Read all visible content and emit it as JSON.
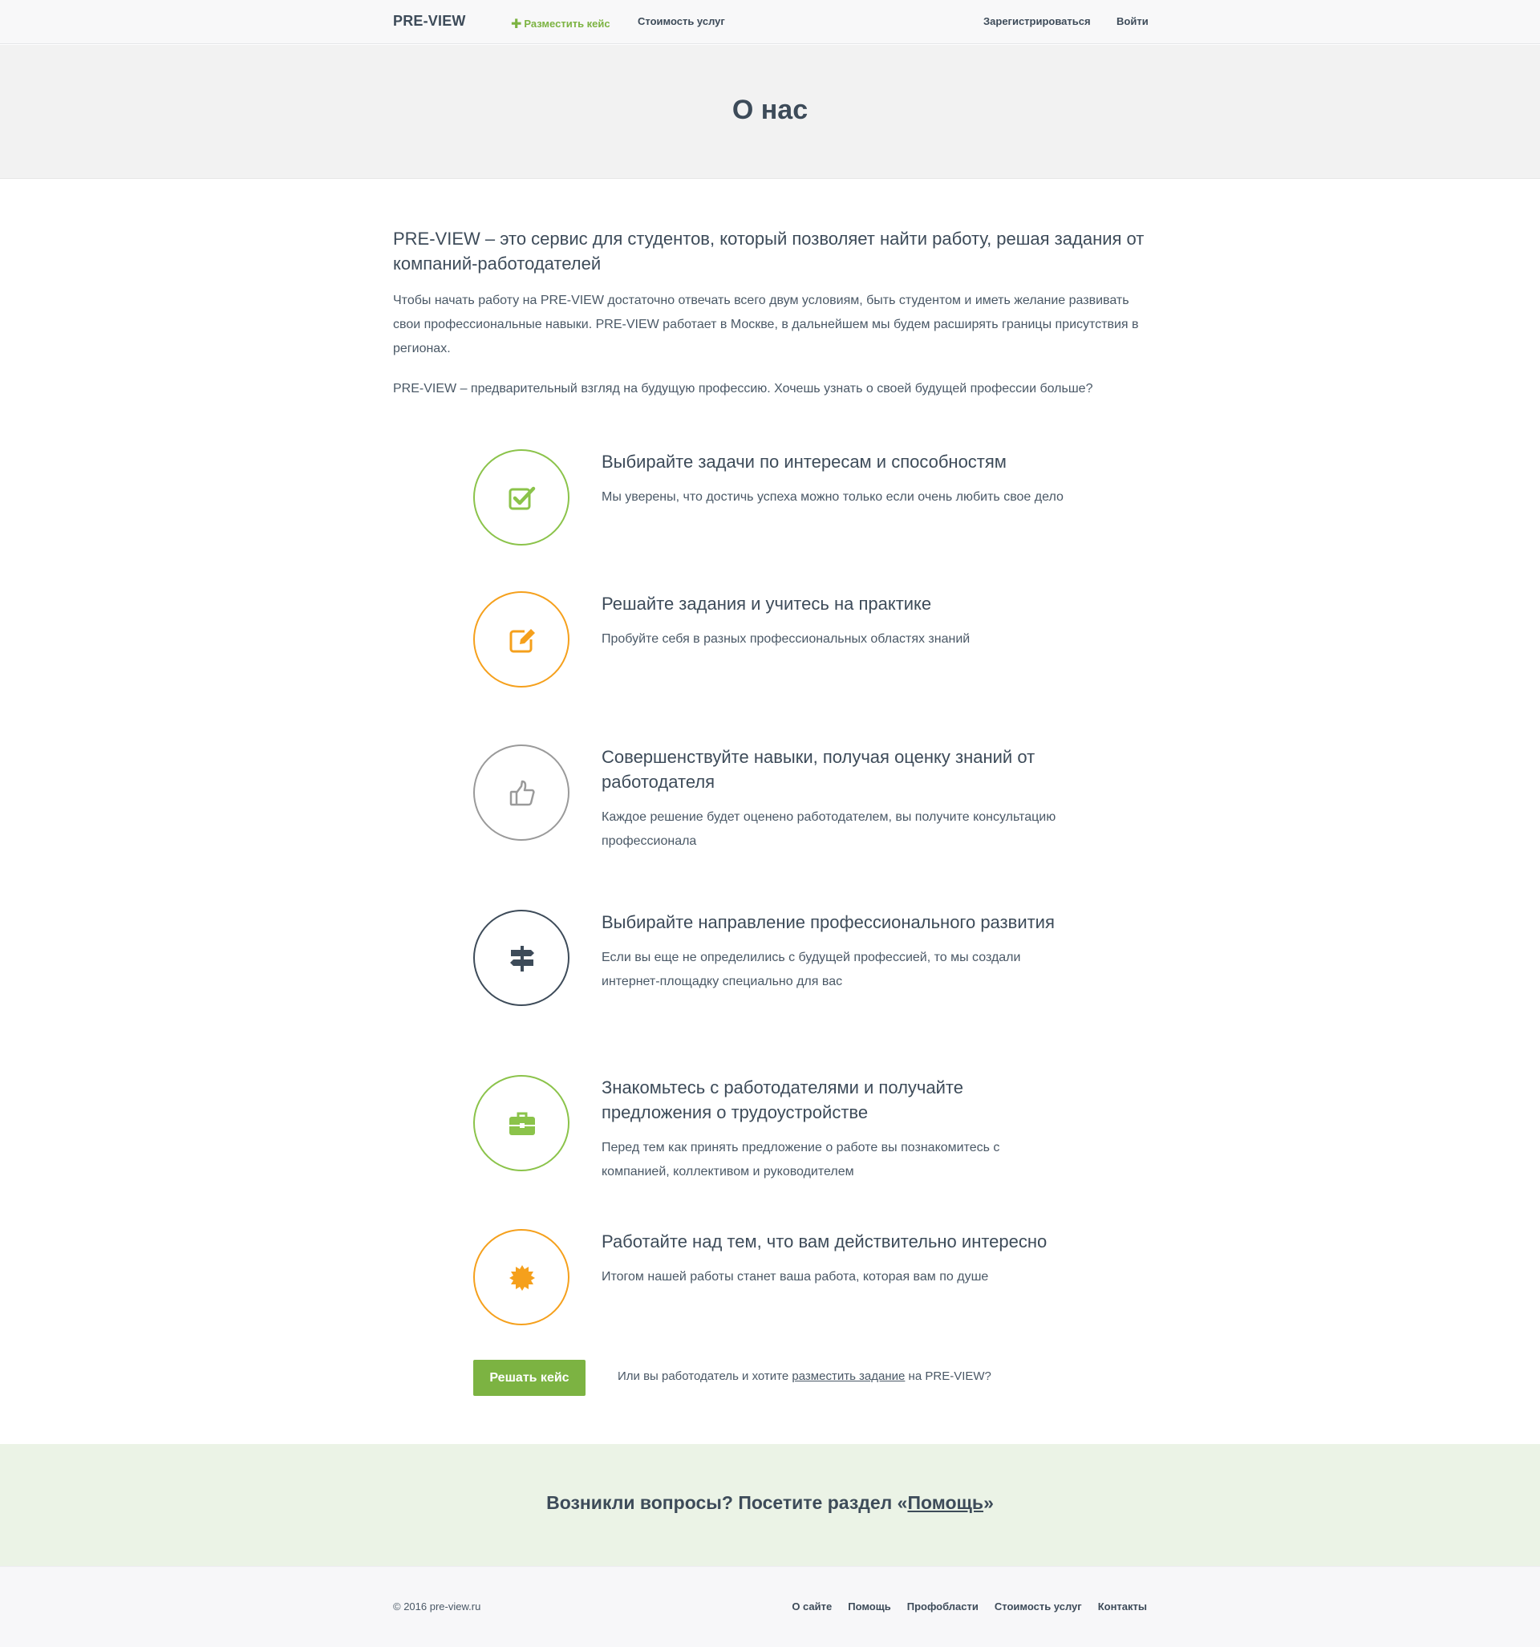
{
  "header": {
    "logo": "PRE-VIEW",
    "add_case_label": "Разместить кейс",
    "pricing_label": "Стоимость услуг",
    "register_label": "Зарегистрироваться",
    "login_label": "Войти"
  },
  "hero": {
    "title": "О нас"
  },
  "intro": {
    "lead": "PRE-VIEW – это сервис для студентов, который позволяет найти работу, решая задания от компаний-работодателей",
    "p1": "Чтобы начать работу на PRE-VIEW достаточно отвечать всего двум условиям, быть студентом и иметь желание развивать свои профессиональные навыки. PRE-VIEW работает в Москве, в дальнейшем мы будем расширять границы присутствия в регионах.",
    "p2": "PRE-VIEW – предварительный взгляд на будущую профессию. Хочешь узнать о своей будущей профессии больше?"
  },
  "features": [
    {
      "icon": "checkbox-icon",
      "color": "#8bc34a",
      "title": "Выбирайте задачи по интересам и способностям",
      "text": "Мы уверены, что достичь успеха можно только если очень любить свое дело"
    },
    {
      "icon": "edit-icon",
      "color": "#f5a01c",
      "title": "Решайте задания и учитесь на практике",
      "text": "Пробуйте себя в разных профессиональных областях знаний"
    },
    {
      "icon": "thumbs-up-icon",
      "color": "#9a9a9a",
      "title": "Совершенствуйте навыки, получая оценку знаний от работодателя",
      "text": "Каждое решение будет оценено работодателем, вы получите консультацию профессионала"
    },
    {
      "icon": "signpost-icon",
      "color": "#3d4b59",
      "title": "Выбирайте направление профессионального развития",
      "text": "Если вы еще не определились с будущей профессией, то мы создали интернет-площадку специально для вас"
    },
    {
      "icon": "briefcase-icon",
      "color": "#8bc34a",
      "title": "Знакомьтесь с работодателями и получайте предложения о трудоустройстве",
      "text": "Перед тем как принять предложение о работе вы познакомитесь с компанией, коллективом и руководителем"
    },
    {
      "icon": "badge-icon",
      "color": "#f5a01c",
      "title": "Работайте над тем, что вам действительно интересно",
      "text": "Итогом нашей работы станет ваша работа, которая вам по душе"
    }
  ],
  "cta": {
    "button": "Решать кейс",
    "note_before": "Или вы работодатель и хотите ",
    "note_link": "разместить задание",
    "note_after": " на PRE-VIEW?"
  },
  "help": {
    "before": "Возникли вопросы? Посетите раздел «",
    "link": "Помощь",
    "after": "»"
  },
  "footer": {
    "copyright": "© 2016 pre-view.ru",
    "links": [
      "О сайте",
      "Помощь",
      "Профобласти",
      "Стоимость услуг",
      "Контакты"
    ]
  }
}
